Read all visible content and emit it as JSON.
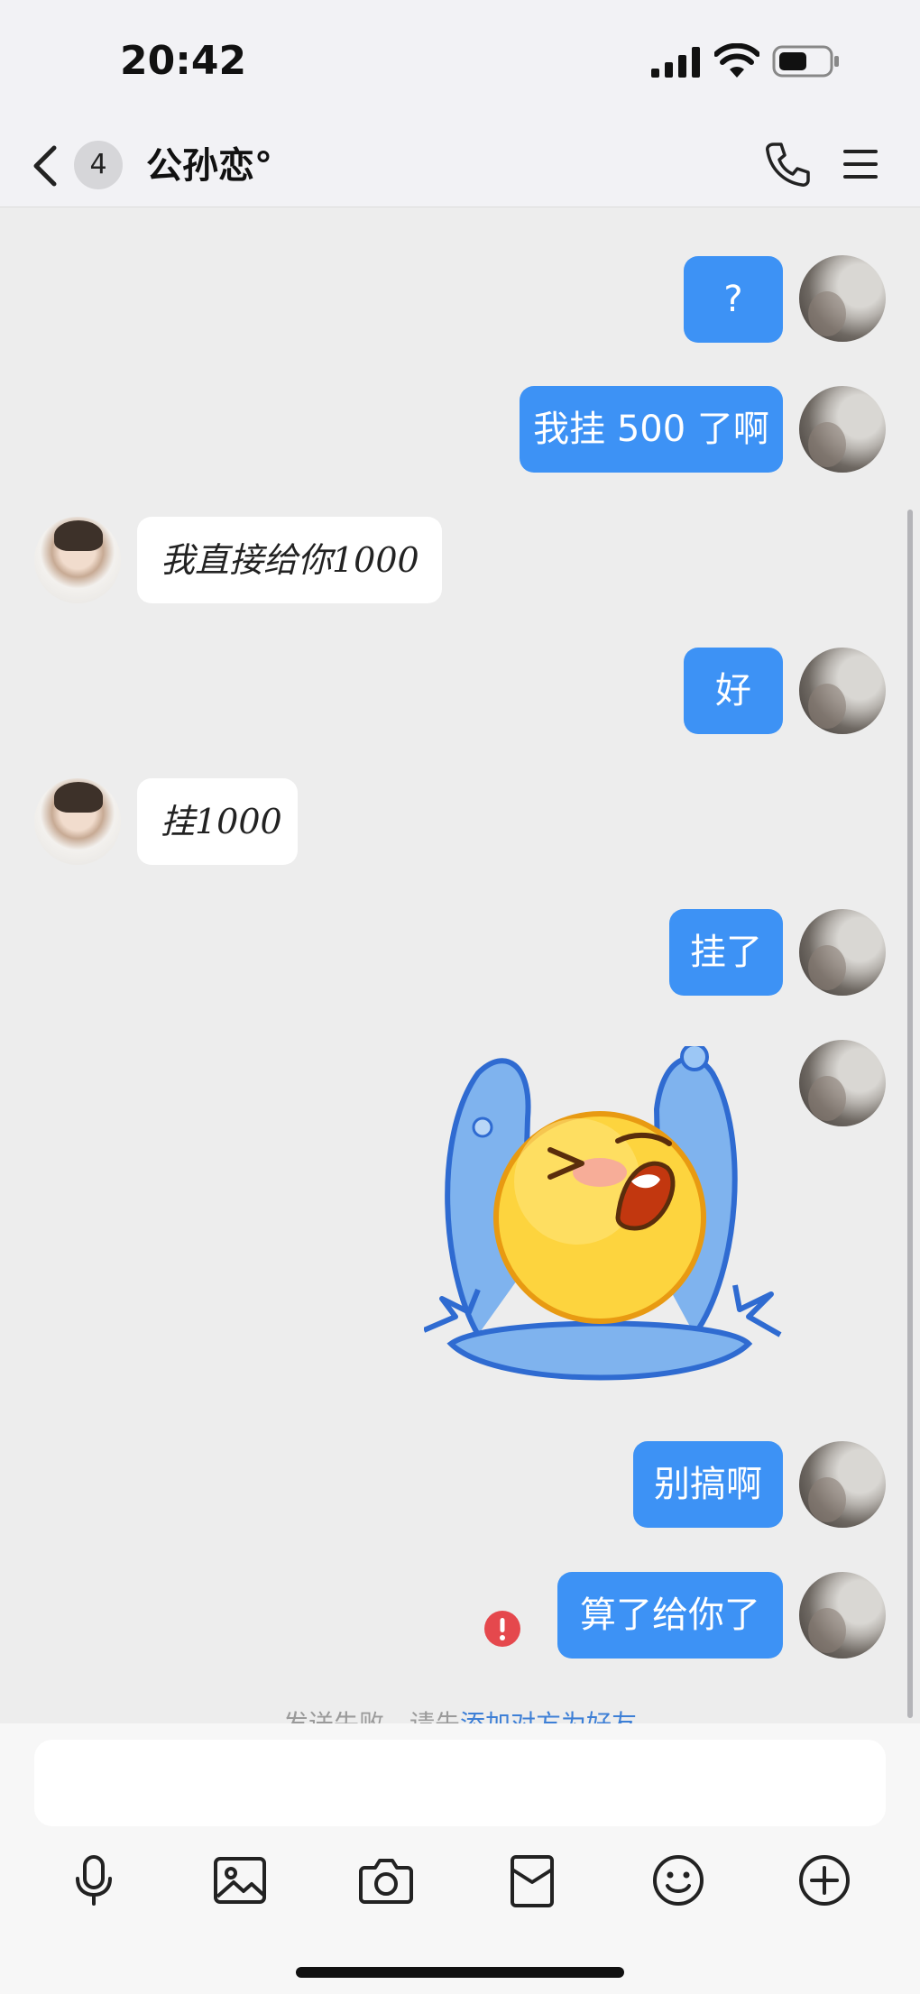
{
  "status_bar": {
    "time": "20:42"
  },
  "header": {
    "unread_count": "4",
    "title": "公孙恋°"
  },
  "messages": [
    {
      "from": "me",
      "text": "?"
    },
    {
      "from": "me",
      "text": "我挂 500 了啊"
    },
    {
      "from": "other",
      "text": "我直接给你1000"
    },
    {
      "from": "me",
      "text": "好"
    },
    {
      "from": "other",
      "text": "挂1000"
    },
    {
      "from": "me",
      "text": "挂了"
    },
    {
      "from": "me",
      "type": "sticker",
      "description": "crying-emoji-sticker"
    },
    {
      "from": "me",
      "text": "别搞啊"
    },
    {
      "from": "me",
      "text": "算了给你了",
      "status": "failed"
    }
  ],
  "notice": {
    "prefix": "发送失败，请先",
    "link": "添加对方为好友"
  },
  "composer": {
    "placeholder": ""
  },
  "toolbar": [
    "mic-icon",
    "image-icon",
    "camera-icon",
    "red-packet-icon",
    "emoji-icon",
    "plus-icon"
  ],
  "colors": {
    "my_bubble": "#3d92f5",
    "other_bubble": "#ffffff",
    "error": "#e5484d",
    "link": "#3d7fd6"
  }
}
